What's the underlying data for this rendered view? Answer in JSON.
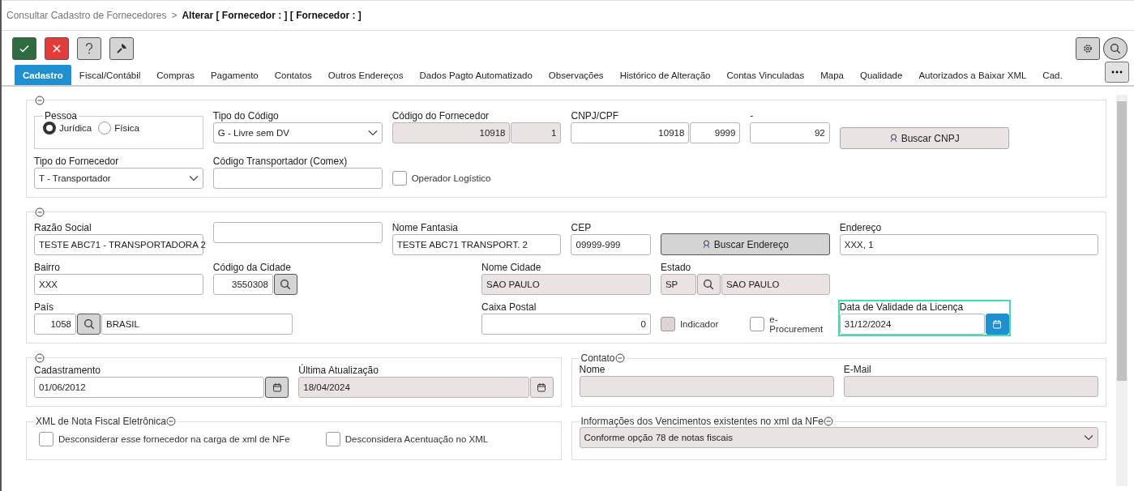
{
  "breadcrumb": {
    "parent": "Consultar Cadastro de Fornecedores",
    "separator": ">",
    "current": "Alterar [ Fornecedor : ] [ Fornecedor : ]"
  },
  "tabs": [
    {
      "label": "Cadastro",
      "selected": true
    },
    {
      "label": "Fiscal/Contábil",
      "selected": false
    },
    {
      "label": "Compras",
      "selected": false
    },
    {
      "label": "Pagamento",
      "selected": false
    },
    {
      "label": "Contatos",
      "selected": false
    },
    {
      "label": "Outros Endereços",
      "selected": false
    },
    {
      "label": "Dados Pagto Automatizado",
      "selected": false
    },
    {
      "label": "Observações",
      "selected": false
    },
    {
      "label": "Histórico de Alteração",
      "selected": false
    },
    {
      "label": "Contas Vinculadas",
      "selected": false
    },
    {
      "label": "Mapa",
      "selected": false
    },
    {
      "label": "Qualidade",
      "selected": false
    },
    {
      "label": "Autorizados a Baixar XML",
      "selected": false
    },
    {
      "label": "Cad.",
      "selected": false
    }
  ],
  "identification": {
    "pessoa": {
      "legend": "Pessoa",
      "options": [
        {
          "label": "Jurídica",
          "selected": true
        },
        {
          "label": "Física",
          "selected": false
        }
      ]
    },
    "tipo_codigo": {
      "label": "Tipo do Código",
      "value": "G - Livre sem DV",
      "disabled": false
    },
    "codigo_fornecedor": {
      "label": "Código do Fornecedor",
      "values": [
        "10918",
        "1"
      ],
      "disabled": true
    },
    "cnpj_cpf": {
      "label": "CNPJ/CPF",
      "values": [
        "10918",
        "9999"
      ],
      "disabled": false
    },
    "digito": {
      "label": "-",
      "value": "92",
      "disabled": false
    },
    "buscar_cnpj": {
      "label": "Buscar CNPJ",
      "disabled": true
    },
    "tipo_fornecedor": {
      "label": "Tipo do Fornecedor",
      "value": "T - Transportador",
      "disabled": false
    },
    "codigo_transportador": {
      "label": "Código Transportador (Comex)",
      "disabled": false
    },
    "operador_logistico": {
      "label": "Operador Logístico",
      "checked": false,
      "disabled": false
    }
  },
  "address": {
    "razao_social": {
      "label": "Razão Social",
      "value": "TESTE ABC71 - TRANSPORTADORA 2",
      "disabled": false
    },
    "nome_fantasia": {
      "label": "Nome Fantasia",
      "value": "TESTE ABC71 TRANSPORT. 2",
      "disabled": false
    },
    "cep": {
      "label": "CEP",
      "value": "09999-999",
      "disabled": false
    },
    "buscar_endereco": {
      "label": "Buscar Endereço",
      "disabled": false
    },
    "endereco": {
      "label": "Endereço",
      "value": "XXX, 1",
      "disabled": false
    },
    "bairro": {
      "label": "Bairro",
      "value": "XXX",
      "disabled": false
    },
    "codigo_cidade": {
      "label": "Código da Cidade",
      "value": "3550308",
      "disabled": false
    },
    "nome_cidade": {
      "label": "Nome Cidade",
      "value": "SAO PAULO",
      "disabled": true
    },
    "estado": {
      "label": "Estado",
      "code": "SP",
      "name": "SAO PAULO",
      "disabled": true
    },
    "pais": {
      "label": "País",
      "code": "1058",
      "name": "BRASIL",
      "disabled": false
    },
    "caixa_postal": {
      "label": "Caixa Postal",
      "value": "0",
      "disabled": false
    },
    "indicador": {
      "label": "Indicador",
      "checked": false,
      "disabled": true
    },
    "e_procurement": {
      "label": "e-Procurement",
      "checked": false,
      "disabled": false
    },
    "data_validade": {
      "label": "Data de Validade da Licença",
      "value": "31/12/2024",
      "disabled": false,
      "focused": true
    }
  },
  "dates": {
    "cadastramento": {
      "label": "Cadastramento",
      "value": "01/06/2012",
      "disabled": false
    },
    "ultima_atualizacao": {
      "label": "Última Atualização",
      "value": "18/04/2024",
      "disabled": true
    }
  },
  "contato": {
    "legend": "Contato",
    "nome": {
      "label": "Nome",
      "disabled": true
    },
    "email": {
      "label": "E-Mail",
      "disabled": true
    }
  },
  "xml_nfe": {
    "legend": "XML de Nota Fiscal Eletrônica",
    "options": [
      {
        "label": "Desconsiderar esse fornecedor na carga de xml de NFe",
        "checked": false
      },
      {
        "label": "Desconsidera Acentuação no XML",
        "checked": false
      }
    ]
  },
  "vencimentos": {
    "legend": "Informações dos Vencimentos existentes no xml da NFe",
    "value": "Conforme opção 78 de notas fiscais",
    "disabled": true
  }
}
